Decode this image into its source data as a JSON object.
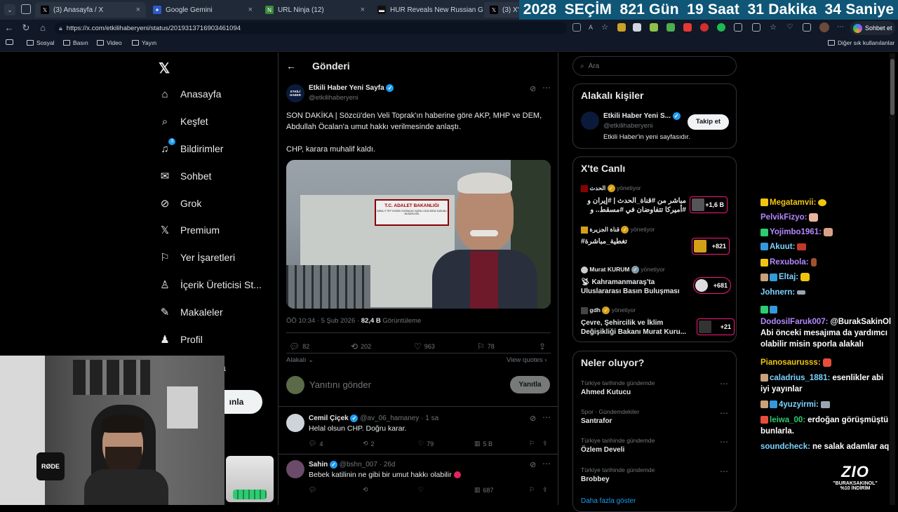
{
  "tabs": [
    {
      "label": "(3) Anasayfa / X",
      "icon": "x-icon"
    },
    {
      "label": "Google Gemini",
      "icon": "gemini-icon"
    },
    {
      "label": "URL Ninja (12)",
      "icon": "ninja-icon"
    },
    {
      "label": "HUR Reveals New Russian Geran-...",
      "icon": "news-icon"
    },
    {
      "label": "(3) X'te E",
      "icon": "x-icon"
    }
  ],
  "countdown": {
    "year": "2028",
    "event": "SEÇİM",
    "days": "821 Gün",
    "hours": "19 Saat",
    "minutes": "31 Dakika",
    "seconds": "34 Saniye"
  },
  "address": {
    "url": "https://x.com/etkilihaberyeni/status/2019313716903461094"
  },
  "sohbet_label": "Sohbet et",
  "bookmarks": [
    "Sosyal",
    "Basın",
    "Video",
    "Yayın"
  ],
  "other_bookmarks": "Diğer sık kullanılanlar",
  "nav": {
    "items": [
      "Anasayfa",
      "Keşfet",
      "Bildirimler",
      "Sohbet",
      "Grok",
      "Premium",
      "Yer İşaretleri",
      "İçerik Üreticisi St...",
      "Makaleler",
      "Profil"
    ],
    "notif_count": "3",
    "hidden_more": "a",
    "post_button_fragment": "ınla"
  },
  "header": {
    "title": "Gönderi"
  },
  "post": {
    "author": "Etkili Haber Yeni Sayfa",
    "handle": "@etkilihaberyeni",
    "avatar_text": "ETKİLİ HABER",
    "text_line1": "SON DAKİKA |  Sözcü'den Veli Toprak'ın haberine göre AKP, MHP ve DEM,",
    "text_line2": "Abdullah Öcalan'a umut hakkı verilmesinde anlaştı.",
    "text_line3": "CHP, karara muhalif kaldı.",
    "sign_text": "T.C. ADALET BAKANLIĞI",
    "sign_sub": "İMRALI F TİPİ YÜKSEK GÜVENLİKLİ KAPALI CEZA İNFAZ KURUMU MÜDÜRLÜĞÜ",
    "time": "ÖÖ 10:34 · 5 Şub 2026 · ",
    "views": "82,4 B",
    "views_label": " Görüntüleme",
    "replies": "82",
    "reposts": "202",
    "likes": "963",
    "bookmarks": "78",
    "relevance": "Alakalı",
    "view_quotes": "View quotes ›",
    "reply_placeholder": "Yanıtını gönder",
    "reply_button": "Yanıtla"
  },
  "replies": [
    {
      "name": "Cemil Çiçek",
      "handle": "@av_06_hamaney · 1 sa",
      "text": "Helal olsun CHP. Doğru karar.",
      "c": "4",
      "r": "2",
      "l": "79",
      "v": "5 B"
    },
    {
      "name": "Sahin",
      "handle": "@bshn_007 · 26d",
      "text": "Bebek katilinin ne gibi bir umut hakkı olabilir",
      "c": "",
      "r": "",
      "l": "",
      "v": "687"
    }
  ],
  "search": {
    "placeholder": "Ara"
  },
  "who": {
    "title": "Alakalı kişiler",
    "name": "Etkili Haber Yeni S...",
    "handle": "@etkilihaberyeni",
    "bio": "Etkili Haber'in yeni sayfasıdır.",
    "follow": "Takip et"
  },
  "live": {
    "title": "X'te Canlı",
    "manages": "yönetiyor",
    "items": [
      {
        "host": "الحدث",
        "line1": "مباشر من #قناة_الحدث | #إيران و",
        "line2": "#أميركا تتفاوضان في #مسقط.. و",
        "badge": "+1,6 B"
      },
      {
        "host": "قناة الجزيرة",
        "line1": "#تغطية_مباشرة",
        "line2": "",
        "badge": "+821"
      },
      {
        "host": "Murat KURUM",
        "line1": "Kahramanmaraş'ta",
        "line2": "Uluslararası Basın Buluşması",
        "badge": "+681"
      },
      {
        "host": "gdh",
        "line1": "Çevre, Şehircilik ve İklim",
        "line2": "Değişikliği Bakanı Murat Kuru...",
        "badge": "+21"
      }
    ]
  },
  "happening": {
    "title": "Neler oluyor?",
    "items": [
      {
        "cat": "Türkiye tarihinde gündemde",
        "name": "Ahmed Kutucu"
      },
      {
        "cat": "Spor · Gündemdekiler",
        "name": "Santrafor"
      },
      {
        "cat": "Türkiye tarihinde gündemde",
        "name": "Özlem Develi"
      },
      {
        "cat": "Türkiye tarihinde gündemde",
        "name": "Brobbey"
      }
    ],
    "more": "Daha fazla göster"
  },
  "chat": [
    {
      "user": "Megatamvii:",
      "msg": "",
      "color": "#f1c40f"
    },
    {
      "user": "PelvikFizyo:",
      "msg": "",
      "color": "#b388ff"
    },
    {
      "user": "Yojimbo1961:",
      "msg": "",
      "color": "#b388ff"
    },
    {
      "user": "Akuut:",
      "msg": "",
      "color": "#7cd3ff"
    },
    {
      "user": "Rexubola:",
      "msg": "",
      "color": "#b388ff"
    },
    {
      "user": "Eltaj:",
      "msg": "",
      "color": "#7cd3ff"
    },
    {
      "user": "Johnern:",
      "msg": "",
      "color": "#7cd3ff"
    },
    {
      "user": "",
      "msg": "",
      "color": "#7cd3ff"
    },
    {
      "user": "DodosilFaruk007:",
      "msg": "@BurakSakinOl",
      "color": "#b388ff"
    },
    {
      "user": "",
      "msg": "Abi önceki mesajıma da yardımcı",
      "color": "#fff"
    },
    {
      "user": "",
      "msg": "olabilir misin sporla alakalı",
      "color": "#fff"
    },
    {
      "user": "Pianosaurusss:",
      "msg": "",
      "color": "#f1c40f"
    },
    {
      "user": "caladrius_1881:",
      "msg": "esenlikler abi",
      "color": "#7cd3ff"
    },
    {
      "user": "",
      "msg": "iyi yayınlar",
      "color": "#fff"
    },
    {
      "user": "4yuzyirmi:",
      "msg": "",
      "color": "#7cd3ff"
    },
    {
      "user": "leiwa_00:",
      "msg": "erdoğan görüşmüştü",
      "color": "#2ecc71"
    },
    {
      "user": "",
      "msg": "bunlarla.",
      "color": "#fff"
    },
    {
      "user": "soundcheck:",
      "msg": "ne salak adamlar aq",
      "color": "#7cd3ff"
    }
  ],
  "logo": {
    "mark": "ZIO",
    "line1": "\"BURAKSAKINOL\"",
    "line2": "%10 İNDİRİM"
  },
  "cam": {
    "mic_label": "RØDE"
  }
}
